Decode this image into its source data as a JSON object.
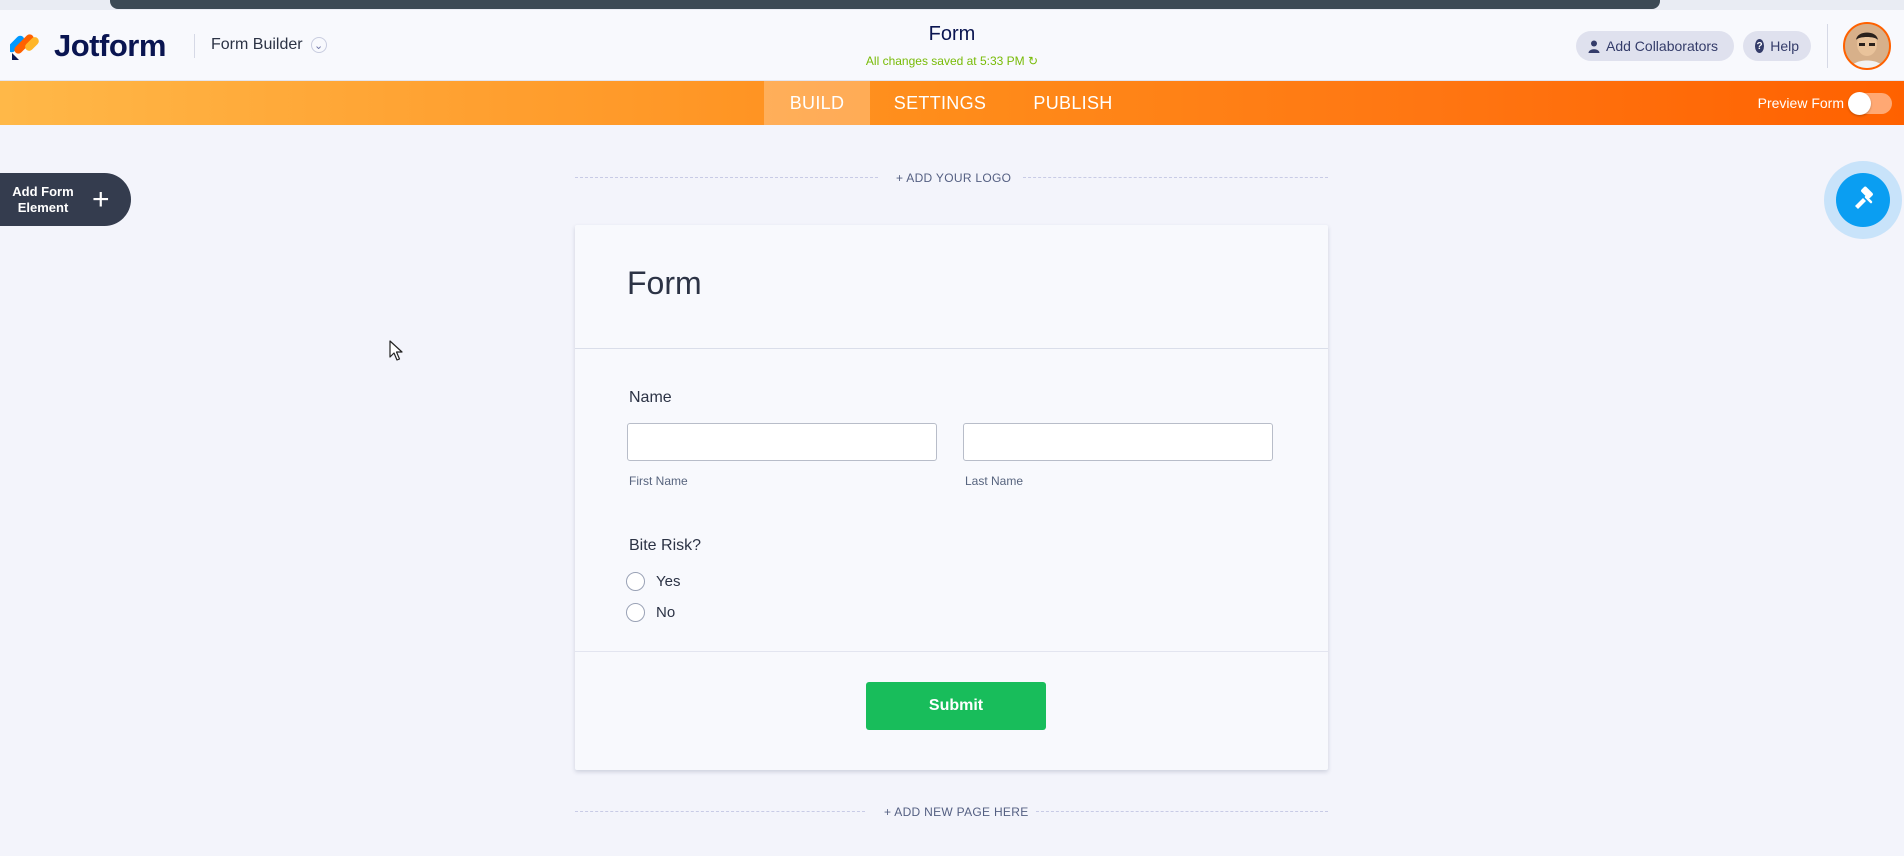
{
  "app": {
    "logo_text": "Jotform",
    "builder_menu": "Form Builder",
    "form_title": "Form",
    "save_status": "All changes saved at 5:33 PM",
    "colors": {
      "accent": "#ff6100",
      "submit": "#18bd5b",
      "paint": "#0a9ef2",
      "dark": "#343c4e"
    }
  },
  "header": {
    "add_collaborators": "Add Collaborators",
    "help": "Help",
    "icons": {
      "collaborators": "person-icon",
      "help": "question-icon",
      "save": "refresh-icon"
    }
  },
  "tabs": [
    {
      "label": "BUILD",
      "active": true
    },
    {
      "label": "SETTINGS",
      "active": false
    },
    {
      "label": "PUBLISH",
      "active": false
    }
  ],
  "preview": {
    "label": "Preview Form",
    "enabled": false
  },
  "sidebar": {
    "add_element_line1": "Add Form",
    "add_element_line2": "Element"
  },
  "canvas": {
    "add_logo": "+ ADD YOUR LOGO",
    "add_page": "+ ADD NEW PAGE HERE"
  },
  "form": {
    "heading": "Form",
    "name_field": {
      "label": "Name",
      "first_sublabel": "First Name",
      "last_sublabel": "Last Name",
      "first_value": "",
      "last_value": ""
    },
    "bite_risk": {
      "label": "Bite Risk?",
      "options": [
        "Yes",
        "No"
      ]
    },
    "submit_label": "Submit"
  }
}
